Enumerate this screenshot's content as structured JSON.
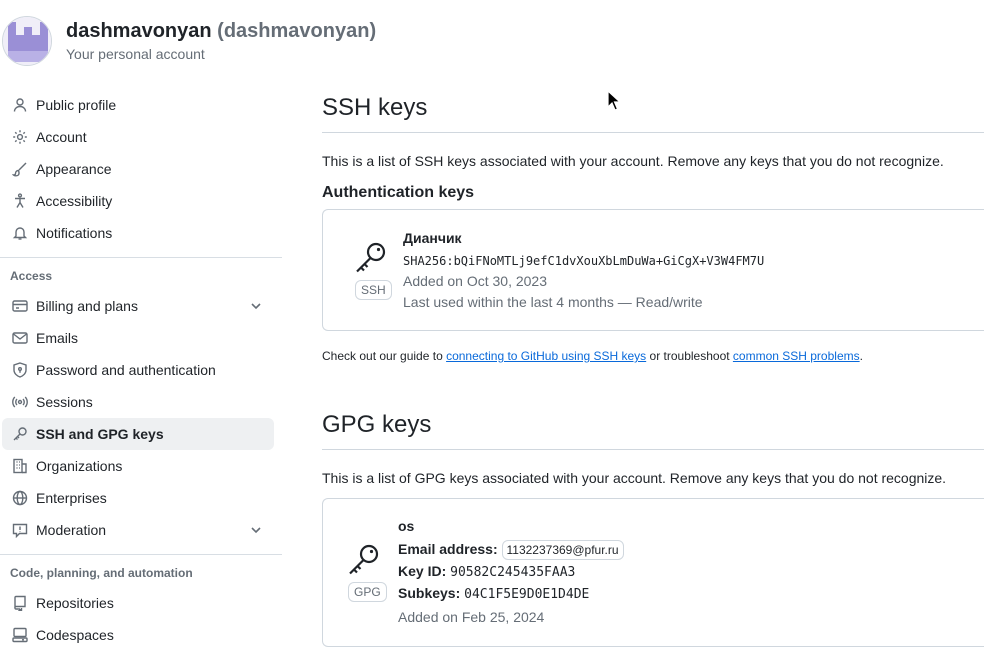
{
  "user": {
    "name": "dashmavonyan",
    "login": "(dashmavonyan)",
    "subtitle": "Your personal account"
  },
  "sidebar": {
    "items": [
      {
        "label": "Public profile",
        "icon": "person-icon"
      },
      {
        "label": "Account",
        "icon": "gear-icon"
      },
      {
        "label": "Appearance",
        "icon": "paintbrush-icon"
      },
      {
        "label": "Accessibility",
        "icon": "accessibility-icon"
      },
      {
        "label": "Notifications",
        "icon": "bell-icon"
      }
    ],
    "access_title": "Access",
    "access_items": [
      {
        "label": "Billing and plans",
        "icon": "credit-card-icon",
        "expandable": true
      },
      {
        "label": "Emails",
        "icon": "mail-icon"
      },
      {
        "label": "Password and authentication",
        "icon": "shield-lock-icon"
      },
      {
        "label": "Sessions",
        "icon": "broadcast-icon"
      },
      {
        "label": "SSH and GPG keys",
        "icon": "key-icon",
        "active": true
      },
      {
        "label": "Organizations",
        "icon": "organization-icon"
      },
      {
        "label": "Enterprises",
        "icon": "globe-icon"
      },
      {
        "label": "Moderation",
        "icon": "report-icon",
        "expandable": true
      }
    ],
    "code_title": "Code, planning, and automation",
    "code_items": [
      {
        "label": "Repositories",
        "icon": "repo-icon"
      },
      {
        "label": "Codespaces",
        "icon": "codespaces-icon"
      }
    ]
  },
  "ssh": {
    "heading": "SSH keys",
    "description": "This is a list of SSH keys associated with your account. Remove any keys that you do not recognize.",
    "auth_heading": "Authentication keys",
    "key": {
      "title": "Дианчик",
      "fingerprint": "SHA256:bQiFNoMTLj9efC1dvXouXbLmDuWa+GiCgX+V3W4FM7U",
      "added": "Added on Oct 30, 2023",
      "last_used": "Last used within the last 4 months — Read/write",
      "tag": "SSH"
    },
    "guide_prefix": "Check out our guide to ",
    "guide_link1": "connecting to GitHub using SSH keys",
    "guide_mid": " or troubleshoot ",
    "guide_link2": "common SSH problems",
    "guide_suffix": "."
  },
  "gpg": {
    "heading": "GPG keys",
    "description": "This is a list of GPG keys associated with your account. Remove any keys that you do not recognize.",
    "key": {
      "title": "os",
      "email_label": "Email address:",
      "email": "1132237369@pfur.ru",
      "keyid_label": "Key ID:",
      "keyid": "90582C245435FAA3",
      "subkeys_label": "Subkeys:",
      "subkeys": "04C1F5E9D0E1D4DE",
      "added": "Added on Feb 25, 2024",
      "tag": "GPG"
    }
  },
  "colors": {
    "link": "#0969da",
    "muted": "#656d76",
    "border": "#d0d7de",
    "active_bg": "#eef0f2"
  }
}
